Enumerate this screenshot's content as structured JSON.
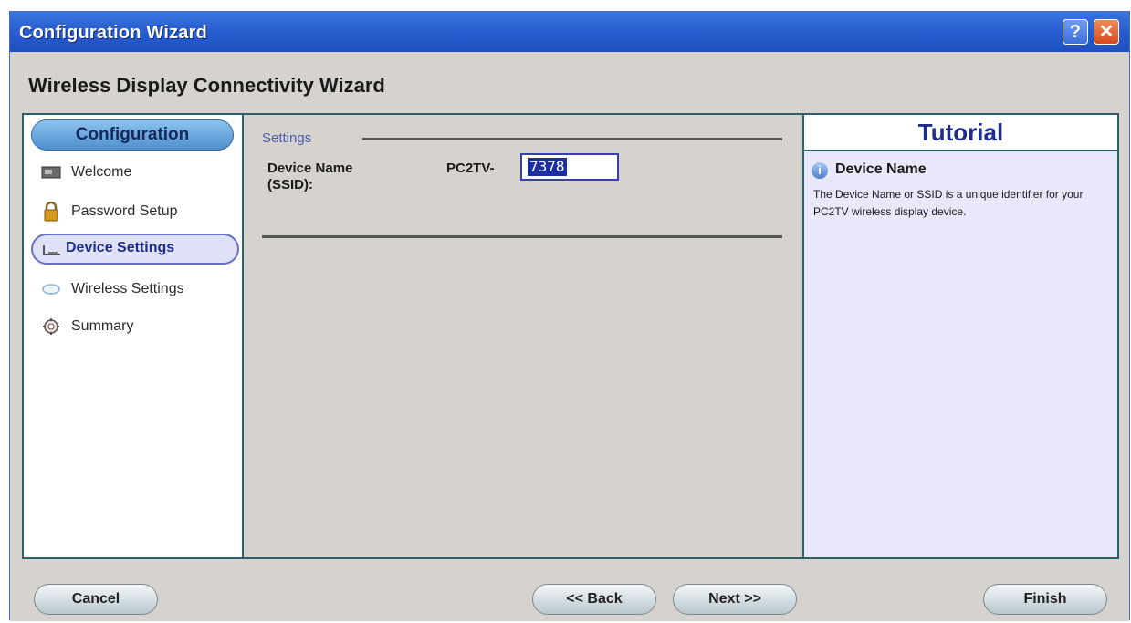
{
  "window": {
    "title": "Configuration Wizard",
    "help_label": "?",
    "close_label": "✕"
  },
  "header": {
    "title": "Wireless Display Connectivity Wizard"
  },
  "sidebar": {
    "section_label": "Configuration",
    "items": [
      {
        "label": "Welcome",
        "icon": "monitor-icon"
      },
      {
        "label": "Password Setup",
        "icon": "lock-icon"
      },
      {
        "label": "Device Settings",
        "icon": "device-icon",
        "active": true
      },
      {
        "label": "Wireless Settings",
        "icon": "wireless-icon"
      },
      {
        "label": "Summary",
        "icon": "gear-icon"
      }
    ]
  },
  "settings": {
    "group_label": "Settings",
    "device_name_label": "Device Name",
    "device_name_sublabel": "(SSID):",
    "prefix": "PC2TV-",
    "value": "7378"
  },
  "tutorial": {
    "heading": "Tutorial",
    "title": "Device Name",
    "body": "The Device Name or SSID is a unique identifier for your PC2TV wireless display device."
  },
  "footer": {
    "cancel_label": "Cancel",
    "back_label": "<< Back",
    "next_label": "Next >>",
    "finish_label": "Finish"
  },
  "colors": {
    "title_bar": "#2a5fd0",
    "accent": "#1f2d8a",
    "pill": "#4f8fcd",
    "panel_bg": "#d6d3ce",
    "tutorial_bg": "#e9e8fb"
  }
}
